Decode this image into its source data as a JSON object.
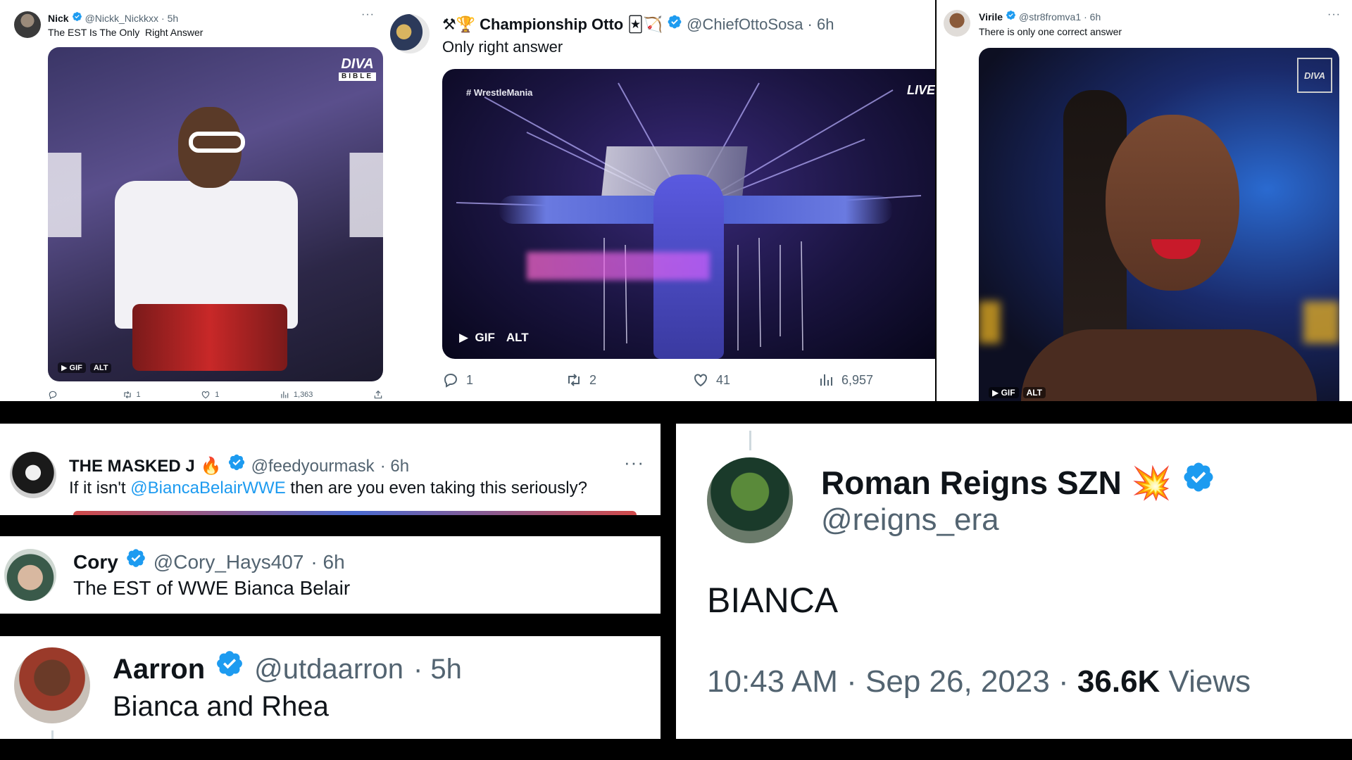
{
  "colors": {
    "accent": "#1d9bf0",
    "text": "#0f1419",
    "muted": "#536471",
    "separator": "#000000"
  },
  "tweet_nick": {
    "name": "Nick",
    "handle": "@Nickk_Nickkxx",
    "time": "· 5h",
    "text": "The EST Is The Only  Right Answer",
    "media": {
      "watermark": "DIVA",
      "watermark_sub": "BIBLE",
      "gif": "GIF",
      "alt": "ALT"
    },
    "stats": {
      "replies": "",
      "reposts": "1",
      "likes": "1",
      "views": "1,363"
    }
  },
  "tweet_otto": {
    "prefix": "⚒🏆",
    "name": "Championship Otto",
    "suffix": "🃏🏹",
    "handle": "@ChiefOttoSosa",
    "time": "· 6h",
    "text": "Only right answer",
    "media": {
      "hashtag": "# WrestleMania",
      "live": "LIVE",
      "gif": "GIF",
      "alt": "ALT"
    },
    "stats": {
      "replies": "1",
      "reposts": "2",
      "likes": "41",
      "views": "6,957"
    }
  },
  "tweet_virile": {
    "name": "Virile",
    "handle": "@str8fromva1",
    "time": "· 6h",
    "text": "There is only one correct answer",
    "media": {
      "watermark": "DIVA",
      "gif": "GIF",
      "alt": "ALT"
    }
  },
  "tweet_masked": {
    "name": "THE MASKED J",
    "emoji": "🔥",
    "handle": "@feedyourmask",
    "time": "· 6h",
    "text_before": "If it isn't ",
    "mention": "@BiancaBelairWWE",
    "text_after": " then are you even taking this seriously?"
  },
  "tweet_cory": {
    "name": "Cory",
    "handle": "@Cory_Hays407",
    "time": "· 6h",
    "text": "The EST of WWE Bianca Belair"
  },
  "tweet_aarron": {
    "name": "Aarron",
    "handle": "@utdaarron",
    "time": "· 5h",
    "text": "Bianca and Rhea"
  },
  "tweet_roman": {
    "name": "Roman Reigns SZN",
    "emoji": "💥",
    "handle": "@reigns_era",
    "text": "BIANCA",
    "timestamp": "10:43 AM · Sep 26, 2023 · ",
    "views_count": "36.6K",
    "views_label": " Views"
  }
}
